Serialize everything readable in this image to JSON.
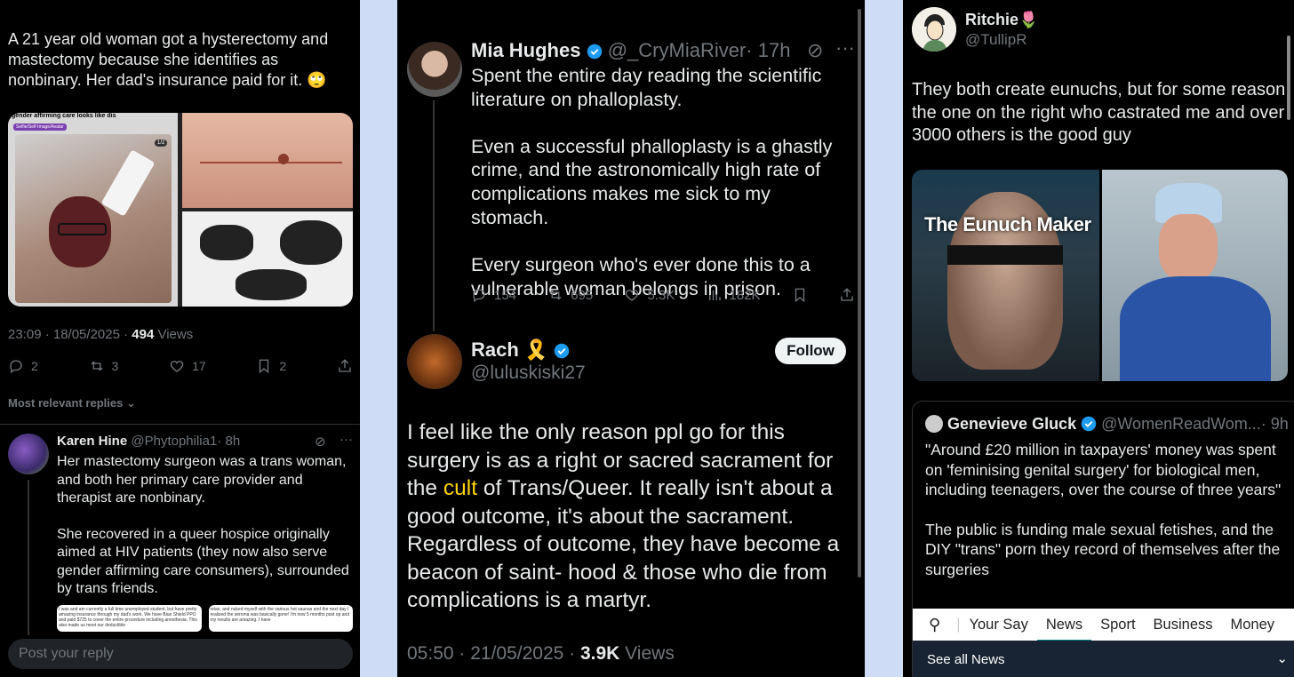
{
  "left": {
    "tweet_text": "A 21 year old woman got a hysterectomy and mastectomy because she identifies as nonbinary. Her dad's insurance paid for it. 🙄",
    "media_caption": "gender affirming care looks like dis",
    "media_tag": "Selfie/Self-Image/Avatar",
    "media_counter": "1/2",
    "time": "23:09 · 18/05/2025 · ",
    "views_count": "494",
    "views_label": " Views",
    "replies": "2",
    "reposts": "3",
    "likes": "17",
    "bookmarks": "2",
    "most_relevant": "Most relevant replies",
    "reply": {
      "name": "Karen Hine",
      "handle": "@Phytophilia1",
      "time": "· 8h",
      "text1": "Her mastectomy surgeon was a trans woman, and both her primary care provider and therapist are nonbinary.",
      "text2": "She recovered in a queer hospice originally aimed at HIV patients (they now also serve gender affirming care consumers), surrounded by trans friends.",
      "img1": "I was and am currently a full time unemployed student, but have pretty amazing insurance through my dad's work. We have Blue Shield PPO and paid $725 to cover the entire procedure including anesthesia. This also made us meet our deductible",
      "img2": "relax, and nuked myself with the various hot saunas and the next day I realized the seroma was basically gone! I'm now 5 months post op and my results are amazing. I have"
    },
    "reply_placeholder": "Post your reply"
  },
  "middle": {
    "author_name": "Mia Hughes",
    "author_handle": "@_CryMiaRiver",
    "author_time": "· 17h",
    "text_p1": "Spent the entire day reading the scientific literature on phalloplasty.",
    "text_p2": "Even a successful phalloplasty is a ghastly crime, and the astronomically high rate of complications makes me sick to my stomach.",
    "text_p3": "Every surgeon who's ever done this to a vulnerable woman belongs in prison.",
    "replies": "154",
    "reposts": "695",
    "likes": "5.3K",
    "views": "182K",
    "reply_name": "Rach",
    "reply_emoji": "🎗️",
    "reply_handle": "@luluskiski27",
    "follow_label": "Follow",
    "reply_text_a": "I feel like the only reason ppl go for this surgery is as a right or sacred sacrament for the ",
    "reply_text_cult": "cult",
    "reply_text_b": " of Trans/Queer. It really isn't about a good outcome, it's about the sacrament. Regardless of outcome, they have become a beacon of saint- hood & those who die from complications is a martyr.",
    "time": "05:50 · 21/05/2025 · ",
    "views_count": "3.9K",
    "views_label": " Views"
  },
  "right": {
    "name": "Ritchie🌷",
    "handle": "@TullipR",
    "text": "They both create eunuchs, but for some reason the one on the right who castrated me and over 3000 others is the good guy",
    "image_title": "The Eunuch Maker",
    "quote": {
      "name": "Genevieve Gluck",
      "handle": "@WomenReadWom...",
      "time": "· 9h",
      "text_p1": "\"Around £20 million in taxpayers' money was spent on 'feminising genital surgery' for biological men, including teenagers, over the course of three years\"",
      "text_p2": "The public is funding male sexual fetishes, and the DIY \"trans\" porn they record of themselves after the surgeries"
    },
    "news_tabs": [
      "Your Say",
      "News",
      "Sport",
      "Business",
      "Money"
    ],
    "see_all": "See all News"
  },
  "colors": {
    "background": "#000000",
    "text": "#e7e9ea",
    "muted": "#71767b",
    "verified": "#1d9bf0",
    "page_bg": "#cfdcf5"
  }
}
